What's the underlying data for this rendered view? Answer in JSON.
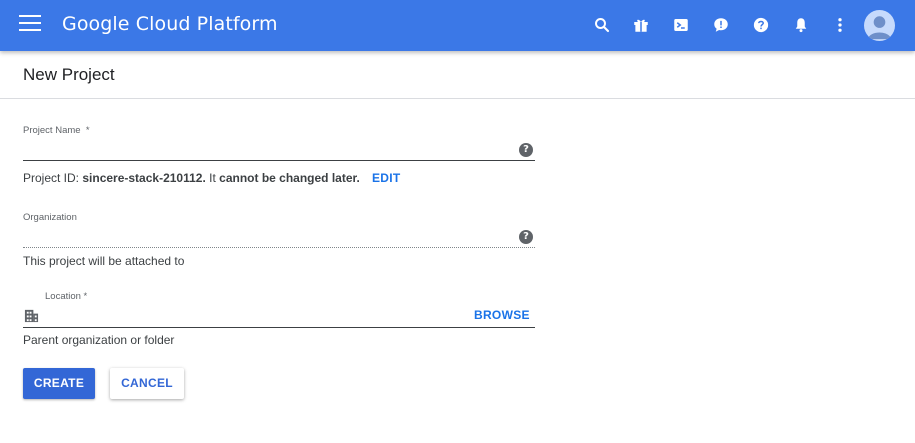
{
  "topbar": {
    "brand": "Google Cloud Platform",
    "icons": [
      "menu-icon",
      "search-icon",
      "gift-icon",
      "cloud-shell-icon",
      "feedback-icon",
      "help-icon",
      "notifications-icon",
      "more-vert-icon",
      "account-icon"
    ],
    "color": "#3b78e7"
  },
  "page": {
    "title": "New Project"
  },
  "form": {
    "project_name": {
      "label": "Project Name",
      "required_mark": "*",
      "value": ""
    },
    "project_id": {
      "prefix": "Project ID:",
      "id": "sincere-stack-210112.",
      "middle": "It",
      "emphasis": "cannot be changed later.",
      "edit_label": "EDIT"
    },
    "organization": {
      "label": "Organization",
      "value": "",
      "hint": "This project will be attached to"
    },
    "location": {
      "label": "Location *",
      "value": "",
      "browse_label": "BROWSE",
      "hint": "Parent organization or folder"
    },
    "help_glyph": "?"
  },
  "actions": {
    "create_label": "CREATE",
    "cancel_label": "CANCEL"
  },
  "colors": {
    "accent": "#1a73e8",
    "primary_button": "#3367d6"
  }
}
